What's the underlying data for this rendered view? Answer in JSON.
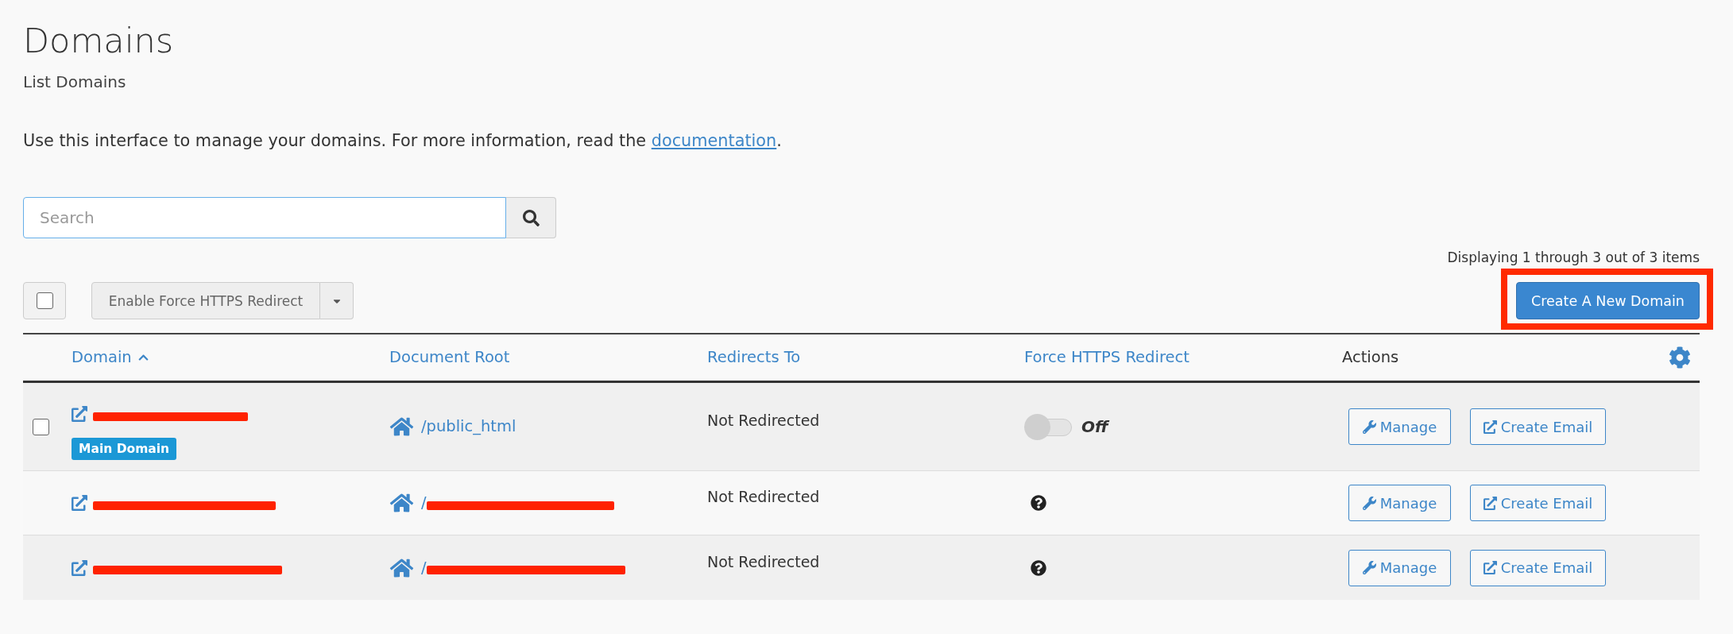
{
  "page": {
    "title": "Domains",
    "subtitle": "List Domains",
    "description": {
      "text": "Use this interface to manage your domains. For more information, read the ",
      "link": "documentation",
      "after": "."
    }
  },
  "search": {
    "placeholder": "Search"
  },
  "pagination_summary": "Displaying 1 through 3 out of 3 items",
  "toolbar": {
    "select_all": {
      "checked": false
    },
    "bulk_action": {
      "label": "Enable Force HTTPS Redirect",
      "disabled": true
    },
    "create_button": {
      "label": "Create A New Domain",
      "highlighted": true
    }
  },
  "table": {
    "columns": [
      {
        "label": "Domain",
        "sortable": true,
        "sorted": true
      },
      {
        "label": "Document Root",
        "sortable": true,
        "sorted": false
      },
      {
        "label": "Redirects To",
        "sortable": true,
        "sorted": false
      },
      {
        "label": "Force HTTPS Redirect",
        "sortable": true,
        "sorted": false
      },
      {
        "label": "Actions",
        "sortable": false,
        "sorted": false
      }
    ],
    "rows": [
      {
        "checkbox": {
          "checked": false
        },
        "domain_redacted": true,
        "badge": "Main Domain",
        "document_root": {
          "text": "/public_html",
          "redacted": false
        },
        "redirects_to": "Not Redirected",
        "force_https": {
          "kind": "toggle",
          "on": false,
          "label": "Off"
        },
        "actions": [
          {
            "kind": "manage",
            "label": "Manage"
          },
          {
            "kind": "email",
            "label": "Create Email"
          }
        ]
      },
      {
        "domain_redacted": true,
        "document_root": {
          "text": "/",
          "redacted": true
        },
        "redirects_to": "Not Redirected",
        "force_https": {
          "kind": "help"
        },
        "actions": [
          {
            "kind": "manage",
            "label": "Manage"
          },
          {
            "kind": "email",
            "label": "Create Email"
          }
        ]
      },
      {
        "domain_redacted": true,
        "document_root": {
          "text": "/",
          "redacted": true
        },
        "redirects_to": "Not Redirected",
        "force_https": {
          "kind": "help"
        },
        "actions": [
          {
            "kind": "manage",
            "label": "Manage"
          },
          {
            "kind": "email",
            "label": "Create Email"
          }
        ]
      }
    ]
  }
}
